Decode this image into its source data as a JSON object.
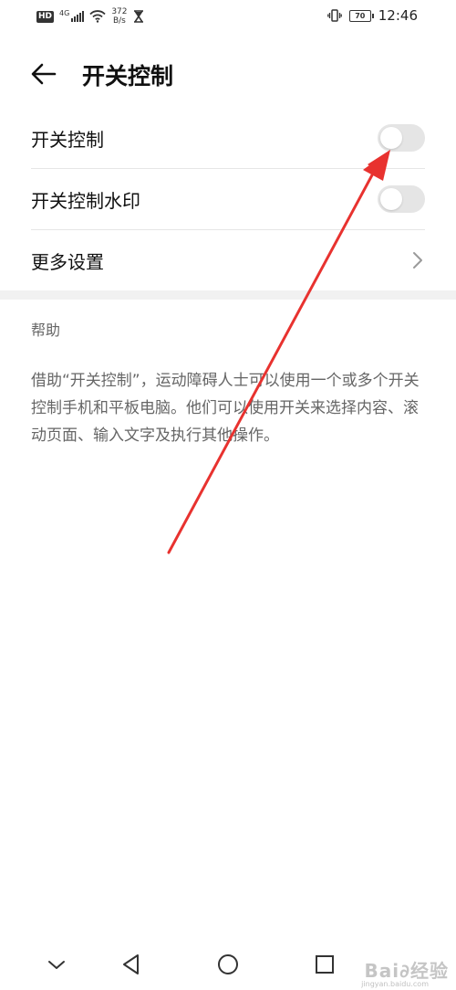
{
  "status_bar": {
    "hd": "HD",
    "network": "4G",
    "speed_value": "372",
    "speed_unit": "B/s",
    "battery": "70",
    "time": "12:46"
  },
  "header": {
    "title": "开关控制"
  },
  "settings": [
    {
      "label": "开关控制",
      "control": "toggle",
      "on": false
    },
    {
      "label": "开关控制水印",
      "control": "toggle",
      "on": false
    },
    {
      "label": "更多设置",
      "control": "chevron"
    }
  ],
  "help": {
    "title": "帮助",
    "text": "借助“开关控制”，运动障碍人士可以使用一个或多个开关控制手机和平板电脑。他们可以使用开关来选择内容、滚动页面、输入文字及执行其他操作。"
  },
  "watermark": {
    "text": "Bai∂经验",
    "sub": "jingyan.baidu.com"
  },
  "colors": {
    "toggle_off": "#e5e5e5",
    "annotation_arrow": "#e8322f"
  }
}
